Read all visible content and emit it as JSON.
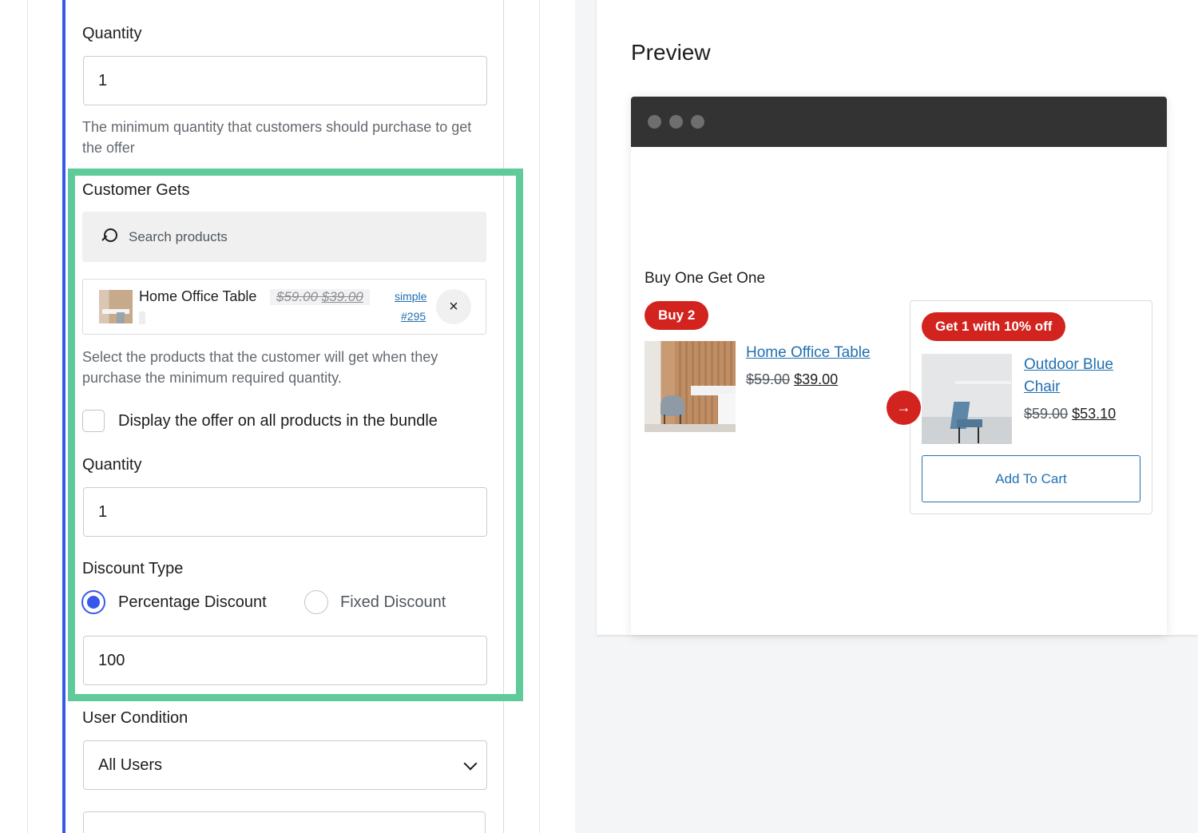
{
  "settings": {
    "buy_quantity": {
      "label": "Quantity",
      "value": "1",
      "help": "The minimum quantity that customers should purchase to get the offer"
    },
    "customer_gets": {
      "label": "Customer Gets",
      "search_placeholder": "Search products",
      "selected_product": {
        "name": "Home Office Table",
        "regular_price": "$59.00",
        "sale_price": "$39.00",
        "type": "simple",
        "id": "#295",
        "remove_label": "×"
      },
      "help": "Select the products that the customer will get when they purchase the minimum required quantity.",
      "display_all_label": "Display the offer on all products in the bundle",
      "quantity_label": "Quantity",
      "quantity_value": "1",
      "discount_type_label": "Discount Type",
      "discount_options": [
        "Percentage Discount",
        "Fixed Discount"
      ],
      "selected_discount": "Percentage Discount",
      "discount_value": "100"
    },
    "user_condition": {
      "label": "User Condition",
      "selected": "All Users"
    }
  },
  "preview": {
    "title": "Preview",
    "offer_title": "Buy One Get One",
    "buy": {
      "badge": "Buy 2",
      "product_name": "Home Office Table",
      "regular_price": "$59.00",
      "sale_price": "$39.00"
    },
    "get": {
      "badge": "Get 1 with 10% off",
      "product_name_line1": "Outdoor Blue",
      "product_name_line2": "Chair",
      "regular_price": "$59.00",
      "sale_price": "$53.10",
      "cart_label": "Add To Cart"
    },
    "arrow": "→"
  },
  "colors": {
    "accent": "#3858e9",
    "highlight": "#5fcb9b",
    "badge_red": "#d3231e",
    "link_blue": "#2271b1"
  }
}
